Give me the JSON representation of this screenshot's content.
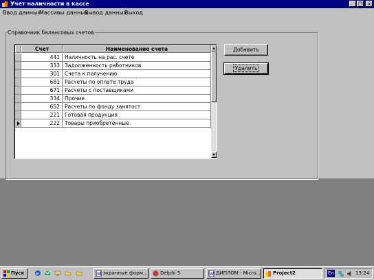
{
  "window": {
    "title": "Учет наличности в кассе",
    "controls": {
      "minimize": "_",
      "maximize": "❐",
      "close": "×"
    }
  },
  "menu": [
    "Ввод данных",
    "Массивы данных",
    "Вывод данных",
    "Выход"
  ],
  "groupbox": {
    "label": "Справочник балансовых счетов"
  },
  "grid": {
    "columns": [
      "Счет",
      "Наименование счета"
    ],
    "rows": [
      {
        "account": "441",
        "name": "Наличность на рас. счете"
      },
      {
        "account": "333",
        "name": "Задолженность работников"
      },
      {
        "account": "301",
        "name": "Счета к получению"
      },
      {
        "account": "681",
        "name": "Расчеты по оплате труда"
      },
      {
        "account": "671",
        "name": "Расчеты с поставщиками"
      },
      {
        "account": "334",
        "name": "Прочие"
      },
      {
        "account": "652",
        "name": "Расчеты по фонду занятост"
      },
      {
        "account": "221",
        "name": "Готовая продукция"
      },
      {
        "account": "222",
        "name": "Товары приобретенные"
      }
    ],
    "current_row_index": 8
  },
  "buttons": {
    "add": "Добавить",
    "delete": "Удалить"
  },
  "taskbar": {
    "start": "Пуск",
    "tasks": [
      {
        "label": "экранные форм...",
        "active": false
      },
      {
        "label": "Delphi 5",
        "active": false
      },
      {
        "label": "ДИПЛОМ - Micro...",
        "active": false
      },
      {
        "label": "Project2",
        "active": true
      }
    ],
    "tray": {
      "language": "En",
      "time": "13:24"
    }
  },
  "colors": {
    "titlebar": "#000080",
    "face": "#c0c0c0",
    "desktop": "#808080"
  }
}
